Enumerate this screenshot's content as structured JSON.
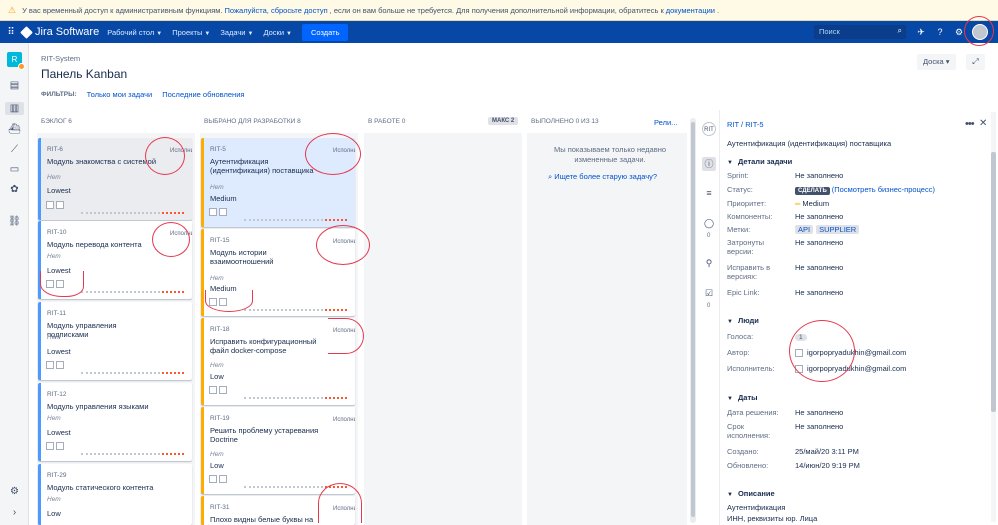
{
  "banner": {
    "text_before": "У вас временный доступ к административным функциям.",
    "link_drop": "Пожалуйста, сбросьте доступ",
    "text_mid": ", если он вам больше не требуется. Для получения дополнительной информации, обратитесь к",
    "link_docs": "документации",
    "text_end": "."
  },
  "topnav": {
    "product": "Jira Software",
    "menus": [
      "Рабочий стол",
      "Проекты",
      "Задачи",
      "Доски"
    ],
    "create": "Создать",
    "search_placeholder": "Поиск"
  },
  "page": {
    "breadcrumb": "RIT-System",
    "title": "Панель Kanban",
    "filters_label": "ФИЛЬТРЫ:",
    "filter_mine": "Только мои задачи",
    "filter_recent": "Последние обновления",
    "board_button": "Доска"
  },
  "columns": [
    {
      "title": "БЭКЛОГ 6"
    },
    {
      "title": "ВЫБРАНО ДЛЯ РАЗРАБОТКИ 8"
    },
    {
      "title": "В РАБОТЕ 0",
      "badge": "МАКС 2"
    },
    {
      "title": "ВЫПОЛНЕНО 0 ИЗ 13",
      "link": "Рели..."
    }
  ],
  "backlog": [
    {
      "key": "RIT-6",
      "summary": "Модуль знакомства с системой",
      "epic": "Hem",
      "priority": "Lowest",
      "avatar": "Исполнитель"
    },
    {
      "key": "RIT-10",
      "summary": "Модуль перевода контента",
      "epic": "Hem",
      "priority": "Lowest",
      "avatar": "Исполнитель"
    },
    {
      "key": "RIT-11",
      "summary": "Модуль управления подписками",
      "epic": "Hem",
      "priority": "Lowest"
    },
    {
      "key": "RIT-12",
      "summary": "Модуль управления языками",
      "epic": "Hem",
      "priority": "Lowest"
    },
    {
      "key": "RIT-29",
      "summary": "Модуль статического контента",
      "epic": "Hem",
      "priority": "Low"
    }
  ],
  "selected": [
    {
      "key": "RIT-5",
      "summary": "Аутентификация (идентификация) поставщика",
      "epic": "Hem",
      "priority": "Medium",
      "avatar": "Исполнитель"
    },
    {
      "key": "RIT-15",
      "summary": "Модуль истории взаимоотношений",
      "epic": "Hem",
      "priority": "Medium",
      "avatar": "Исполнитель"
    },
    {
      "key": "RIT-18",
      "summary": "Исправить конфигурационный файл docker-compose",
      "epic": "Hem",
      "priority": "Low",
      "avatar": "Исполнитель"
    },
    {
      "key": "RIT-19",
      "summary": "Решить проблему устаревания Doctrine",
      "epic": "Hem",
      "priority": "Low",
      "avatar": "Исполнитель"
    },
    {
      "key": "RIT-31",
      "summary": "Плохо видны белые буквы на",
      "avatar": "Исполнитель"
    }
  ],
  "done_empty": {
    "text": "Мы показываем только недавно измененные задачи.",
    "link": "Ищете более старую задачу?"
  },
  "panel_counts": [
    "0",
    "0"
  ],
  "detail": {
    "project": "RIT",
    "key": "RIT-5",
    "title": "Аутентификация (идентификация) поставщика",
    "sections": {
      "details": "Детали задачи",
      "people": "Люди",
      "dates": "Даты",
      "description": "Описание"
    },
    "fields": {
      "sprint": {
        "label": "Sprint:",
        "value": "Не заполнено"
      },
      "status": {
        "label": "Статус:",
        "lozenge": "СДЕЛАТЬ",
        "link": "(Посмотреть бизнес-процесс)"
      },
      "priority": {
        "label": "Приоритет:",
        "value": "Medium"
      },
      "components": {
        "label": "Компоненты:",
        "value": "Не заполнено"
      },
      "labels": {
        "label": "Метки:",
        "tags": [
          "API",
          "SUPPLIER"
        ]
      },
      "affects": {
        "label": "Затронуты версии:",
        "value": "Не заполнено"
      },
      "fix": {
        "label": "Исправить в версиях:",
        "value": "Не заполнено"
      },
      "epic": {
        "label": "Epic Link:",
        "value": "Не заполнено"
      }
    },
    "people": {
      "votes": {
        "label": "Голоса:",
        "value": "1"
      },
      "reporter": {
        "label": "Автор:",
        "value": "igorpopryadukhin@gmail.com"
      },
      "assignee": {
        "label": "Исполнитель:",
        "value": "igorpopryadukhin@gmail.com"
      }
    },
    "dates": {
      "resolved": {
        "label": "Дата решения:",
        "value": "Не заполнено"
      },
      "due": {
        "label": "Срок исполнения:",
        "value": "Не заполнено"
      },
      "created": {
        "label": "Создано:",
        "value": "25/май/20 3:11 PM"
      },
      "updated": {
        "label": "Обновлено:",
        "value": "14/июн/20 9:19 PM"
      }
    },
    "description_lines": [
      "Аутентификация",
      "ИНН, реквизиты юр. Лица"
    ]
  },
  "colors": {
    "nav": "#0747a6",
    "accent": "#0065ff",
    "annotation": "#e5394f"
  }
}
